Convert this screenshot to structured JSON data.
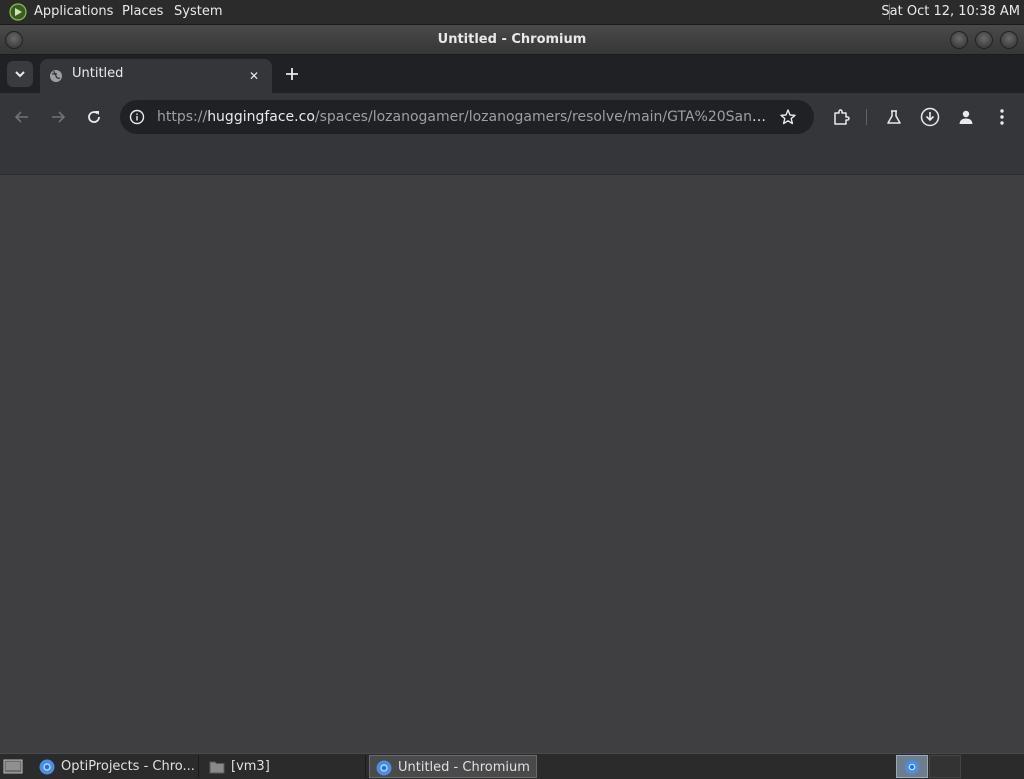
{
  "top_panel": {
    "applications": "Applications",
    "places": "Places",
    "system": "System",
    "clock": "Sat Oct 12, 10:38 AM"
  },
  "window": {
    "title": "Untitled - Chromium"
  },
  "tabs": [
    {
      "title": "Untitled",
      "close_glyph": "✕",
      "active": true
    }
  ],
  "toolbar": {
    "url_scheme": "https://",
    "url_host": "huggingface.co",
    "url_path": "/spaces/lozanogamer/lozanogamers/resolve/main/GTA%20San%20Andr..."
  },
  "taskbar": {
    "tasks": [
      {
        "label": "OptiProjects - Chro...",
        "icon": "chromium-icon"
      },
      {
        "label": "[vm3]",
        "icon": "folder-icon"
      },
      {
        "label": "Untitled - Chromium",
        "icon": "chromium-icon",
        "active": true
      }
    ]
  },
  "colors": {
    "page_background": "#3f3f42",
    "toolbar": "#35363a",
    "tabstrip": "#202124",
    "panel": "#2b2b2b"
  }
}
